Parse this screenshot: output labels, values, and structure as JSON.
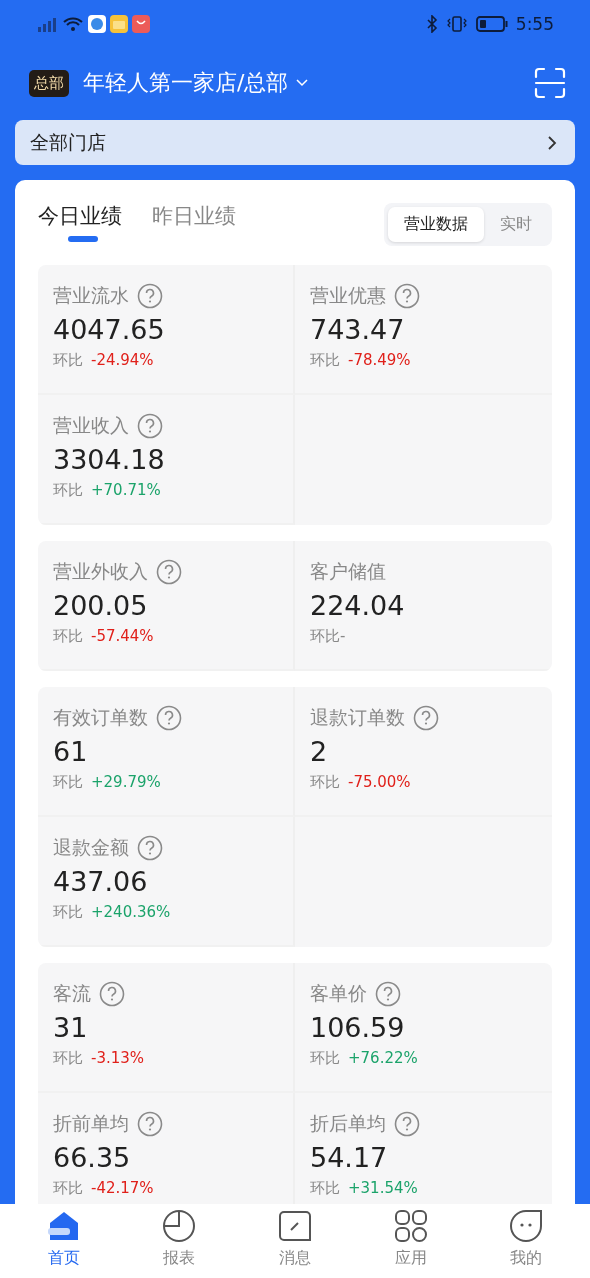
{
  "status_bar": {
    "time": "5:55"
  },
  "header": {
    "badge": "总部",
    "store": "年轻人第一家店/总部"
  },
  "store_filter": {
    "label": "全部门店"
  },
  "tabs": [
    {
      "label": "今日业绩",
      "selected": true
    },
    {
      "label": "昨日业绩",
      "selected": false
    }
  ],
  "segments": [
    {
      "label": "营业数据",
      "selected": true
    },
    {
      "label": "实时",
      "selected": false
    }
  ],
  "groups": [
    {
      "metrics": [
        {
          "label": "营业流水",
          "help": true,
          "value": "4047.65",
          "compare": "环比",
          "change": "-24.94%",
          "kind": "down"
        },
        {
          "label": "营业优惠",
          "help": true,
          "value": "743.47",
          "compare": "环比",
          "change": "-78.49%",
          "kind": "down"
        },
        {
          "label": "营业收入",
          "help": true,
          "value": "3304.18",
          "compare": "环比",
          "change": "+70.71%",
          "kind": "up"
        }
      ]
    },
    {
      "metrics": [
        {
          "label": "营业外收入",
          "help": true,
          "value": "200.05",
          "compare": "环比",
          "change": "-57.44%",
          "kind": "down"
        },
        {
          "label": "客户储值",
          "help": false,
          "value": "224.04",
          "compare": "环比-"
        }
      ]
    },
    {
      "metrics": [
        {
          "label": "有效订单数",
          "help": true,
          "value": "61",
          "compare": "环比",
          "change": "+29.79%",
          "kind": "up"
        },
        {
          "label": "退款订单数",
          "help": true,
          "value": "2",
          "compare": "环比",
          "change": "-75.00%",
          "kind": "down"
        },
        {
          "label": "退款金额",
          "help": true,
          "value": "437.06",
          "compare": "环比",
          "change": "+240.36%",
          "kind": "up"
        }
      ]
    },
    {
      "metrics": [
        {
          "label": "客流",
          "help": true,
          "value": "31",
          "compare": "环比",
          "change": "-3.13%",
          "kind": "down"
        },
        {
          "label": "客单价",
          "help": true,
          "value": "106.59",
          "compare": "环比",
          "change": "+76.22%",
          "kind": "up"
        },
        {
          "label": "折前单均",
          "help": true,
          "value": "66.35",
          "compare": "环比",
          "change": "-42.17%",
          "kind": "down"
        },
        {
          "label": "折后单均",
          "help": true,
          "value": "54.17",
          "compare": "环比",
          "change": "+31.54%",
          "kind": "up"
        }
      ]
    }
  ],
  "bottom_nav": [
    {
      "label": "首页",
      "kind": "home",
      "selected": true
    },
    {
      "label": "报表",
      "kind": "report",
      "selected": false
    },
    {
      "label": "消息",
      "kind": "message",
      "selected": false
    },
    {
      "label": "应用",
      "kind": "apps",
      "selected": false
    },
    {
      "label": "我的",
      "kind": "profile",
      "selected": false
    }
  ]
}
